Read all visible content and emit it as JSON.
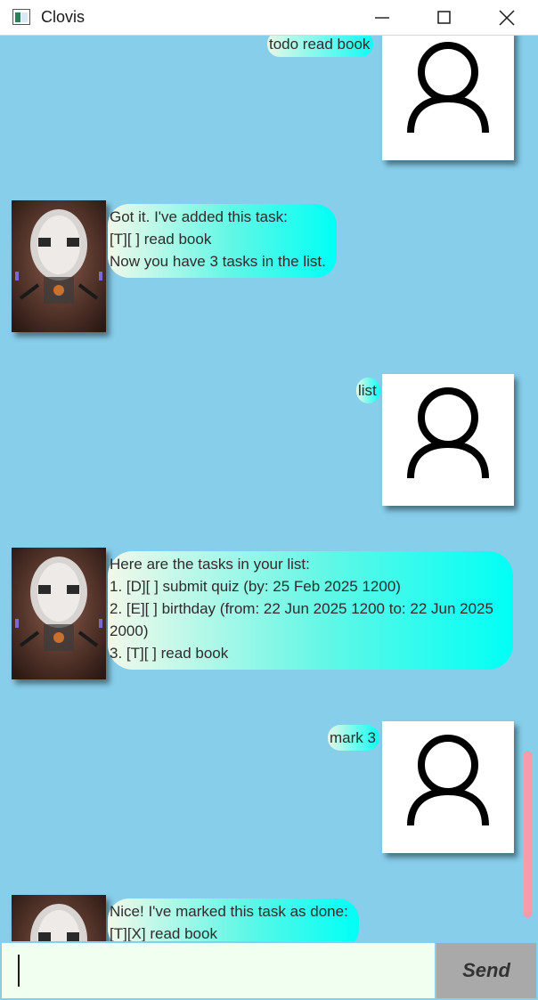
{
  "window": {
    "title": "Clovis",
    "icon": "app-window-icon",
    "controls": [
      "minimize-icon",
      "maximize-icon",
      "close-icon"
    ]
  },
  "messages": [
    {
      "sender": "user",
      "text": "todo read book"
    },
    {
      "sender": "bot",
      "lines": [
        "Got it. I've added this task:",
        "[T][ ] read book",
        "Now you have 3 tasks in the list."
      ]
    },
    {
      "sender": "user",
      "text": "list"
    },
    {
      "sender": "bot",
      "lines": [
        "Here are the tasks in your list:",
        "1. [D][ ] submit quiz (by: 25 Feb 2025 1200)",
        "2. [E][ ] birthday (from: 22 Jun 2025 1200 to: 22 Jun 2025 2000)",
        "3. [T][ ] read book"
      ]
    },
    {
      "sender": "user",
      "text": "mark 3"
    },
    {
      "sender": "bot",
      "lines": [
        "Nice! I've marked this task as done:",
        "[T][X] read book"
      ]
    }
  ],
  "input": {
    "value": "",
    "placeholder": ""
  },
  "send_button": {
    "label": "Send"
  },
  "colors": {
    "background": "#87ceeb",
    "input_background": "#f0fff0",
    "send_button": "#a9a9a9",
    "scrollbar": "#f59cab",
    "bubble_gradient_end": "#00fff6"
  }
}
